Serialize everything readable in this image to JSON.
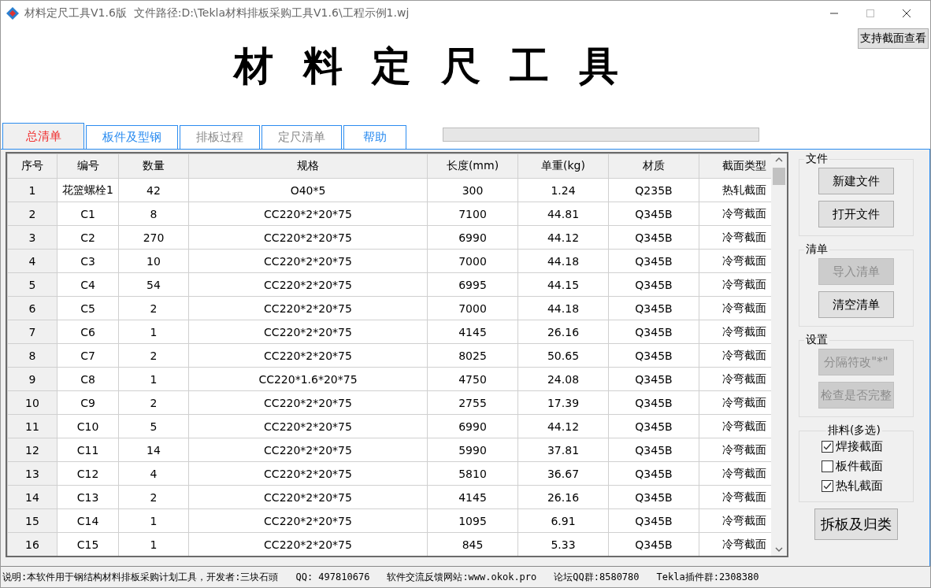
{
  "window": {
    "title": "材料定尺工具V1.6版  文件路径:D:\\Tekla材料排板采购工具V1.6\\工程示例1.wj"
  },
  "top_button": "支持截面查看",
  "heading": "材 料 定 尺 工 具",
  "tabs": [
    {
      "label": "总清单",
      "selected": true,
      "disabled": false
    },
    {
      "label": "板件及型钢",
      "selected": false,
      "disabled": false
    },
    {
      "label": "排板过程",
      "selected": false,
      "disabled": true
    },
    {
      "label": "定尺清单",
      "selected": false,
      "disabled": true
    },
    {
      "label": "帮助",
      "selected": false,
      "disabled": false
    }
  ],
  "progress": {
    "level": 0
  },
  "table": {
    "columns": [
      "序号",
      "编号",
      "数量",
      "规格",
      "长度(mm)",
      "单重(kg)",
      "材质",
      "截面类型"
    ],
    "rows": [
      [
        "1",
        "花篮螺栓1",
        "42",
        "O40*5",
        "300",
        "1.24",
        "Q235B",
        "热轧截面"
      ],
      [
        "2",
        "C1",
        "8",
        "CC220*2*20*75",
        "7100",
        "44.81",
        "Q345B",
        "冷弯截面"
      ],
      [
        "3",
        "C2",
        "270",
        "CC220*2*20*75",
        "6990",
        "44.12",
        "Q345B",
        "冷弯截面"
      ],
      [
        "4",
        "C3",
        "10",
        "CC220*2*20*75",
        "7000",
        "44.18",
        "Q345B",
        "冷弯截面"
      ],
      [
        "5",
        "C4",
        "54",
        "CC220*2*20*75",
        "6995",
        "44.15",
        "Q345B",
        "冷弯截面"
      ],
      [
        "6",
        "C5",
        "2",
        "CC220*2*20*75",
        "7000",
        "44.18",
        "Q345B",
        "冷弯截面"
      ],
      [
        "7",
        "C6",
        "1",
        "CC220*2*20*75",
        "4145",
        "26.16",
        "Q345B",
        "冷弯截面"
      ],
      [
        "8",
        "C7",
        "2",
        "CC220*2*20*75",
        "8025",
        "50.65",
        "Q345B",
        "冷弯截面"
      ],
      [
        "9",
        "C8",
        "1",
        "CC220*1.6*20*75",
        "4750",
        "24.08",
        "Q345B",
        "冷弯截面"
      ],
      [
        "10",
        "C9",
        "2",
        "CC220*2*20*75",
        "2755",
        "17.39",
        "Q345B",
        "冷弯截面"
      ],
      [
        "11",
        "C10",
        "5",
        "CC220*2*20*75",
        "6990",
        "44.12",
        "Q345B",
        "冷弯截面"
      ],
      [
        "12",
        "C11",
        "14",
        "CC220*2*20*75",
        "5990",
        "37.81",
        "Q345B",
        "冷弯截面"
      ],
      [
        "13",
        "C12",
        "4",
        "CC220*2*20*75",
        "5810",
        "36.67",
        "Q345B",
        "冷弯截面"
      ],
      [
        "14",
        "C13",
        "2",
        "CC220*2*20*75",
        "4145",
        "26.16",
        "Q345B",
        "冷弯截面"
      ],
      [
        "15",
        "C14",
        "1",
        "CC220*2*20*75",
        "1095",
        "6.91",
        "Q345B",
        "冷弯截面"
      ],
      [
        "16",
        "C15",
        "1",
        "CC220*2*20*75",
        "845",
        "5.33",
        "Q345B",
        "冷弯截面"
      ]
    ]
  },
  "groups": [
    {
      "title": "文件",
      "buttons": [
        {
          "label": "新建文件",
          "disabled": false
        },
        {
          "label": "打开文件",
          "disabled": false
        }
      ]
    },
    {
      "title": "清单",
      "buttons": [
        {
          "label": "导入清单",
          "disabled": true
        },
        {
          "label": "清空清单",
          "disabled": false
        }
      ]
    },
    {
      "title": "设置",
      "buttons": [
        {
          "label": "分隔符改\"*\"",
          "disabled": true
        },
        {
          "label": "检查是否完整",
          "disabled": true
        }
      ]
    }
  ],
  "nesting": {
    "title": "排料(多选)",
    "options": [
      {
        "label": "焊接截面",
        "checked": true
      },
      {
        "label": "板件截面",
        "checked": false
      },
      {
        "label": "热轧截面",
        "checked": true
      }
    ]
  },
  "main_button": "拆板及归类",
  "status_bar": [
    "说明:本软件用于钢结构材料排板采购计划工具，开发者:三块石頭",
    "QQ: 497810676",
    "软件交流反馈网站:www.okok.pro",
    "论坛QQ群:8580780",
    "Tekla插件群:2308380"
  ]
}
